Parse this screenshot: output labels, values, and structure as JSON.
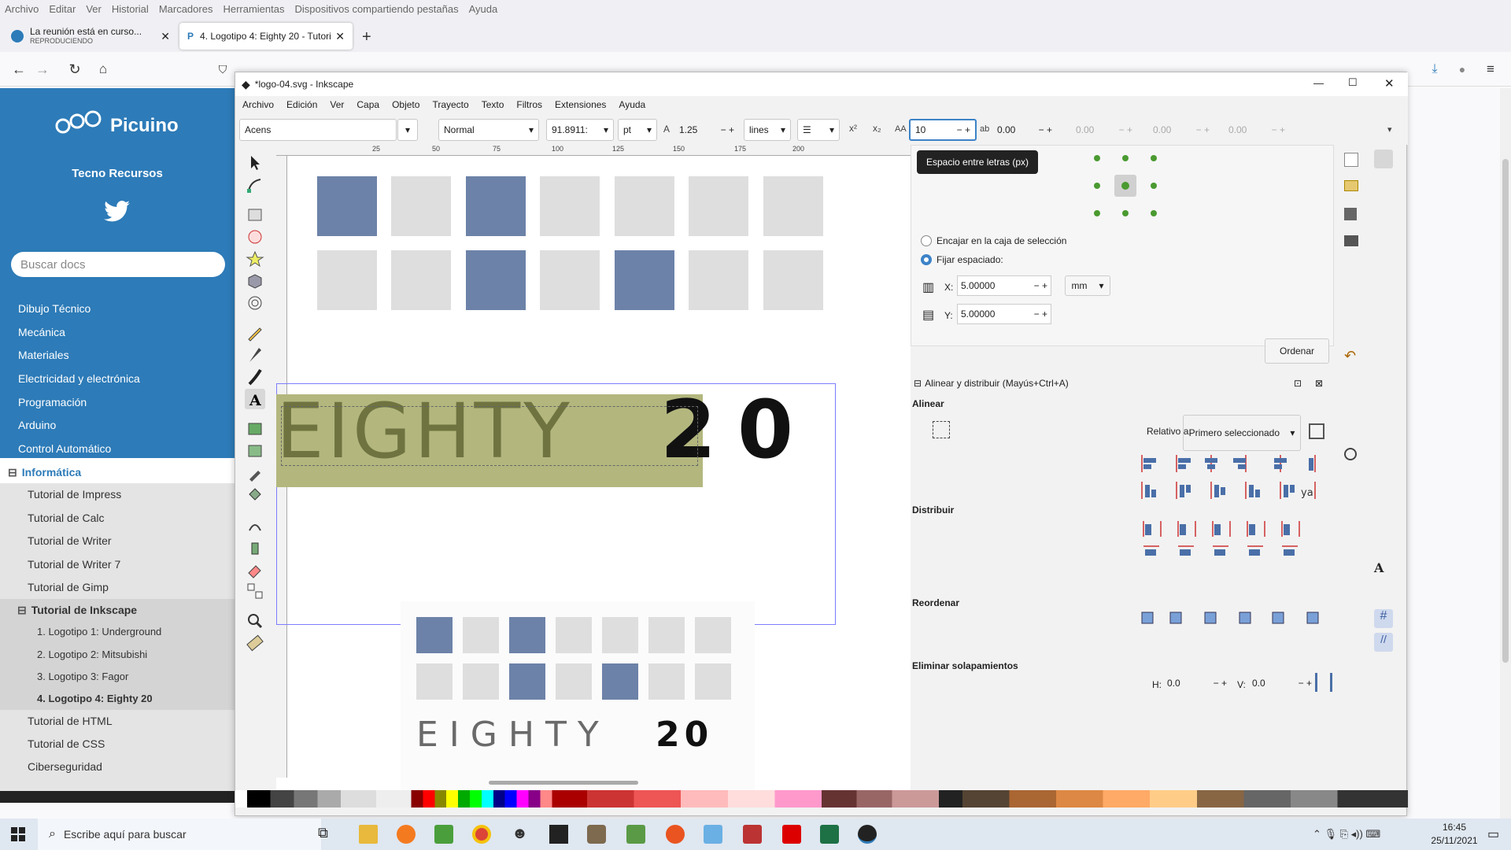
{
  "firefox": {
    "menu": [
      "Archivo",
      "Editar",
      "Ver",
      "Historial",
      "Marcadores",
      "Herramientas",
      "Dispositivos compartiendo pestañas",
      "Ayuda"
    ],
    "tab1": {
      "title": "La reunión está en curso...",
      "subtitle": "REPRODUCIENDO"
    },
    "tab2": {
      "title": "4. Logotipo 4: Eighty 20 - Tutori"
    }
  },
  "site": {
    "brand": "Picuino",
    "subtitle": "Tecno Recursos",
    "search_placeholder": "Buscar docs",
    "nav": [
      "Dibujo Técnico",
      "Mecánica",
      "Materiales",
      "Electricidad y electrónica",
      "Programación",
      "Arduino",
      "Control Automático"
    ],
    "section": "Informática",
    "items": [
      "Tutorial de Impress",
      "Tutorial de Calc",
      "Tutorial de Writer",
      "Tutorial de Writer 7",
      "Tutorial de Gimp"
    ],
    "current_section": "Tutorial de Inkscape",
    "subitems": [
      "1. Logotipo 1: Underground",
      "2. Logotipo 2: Mitsubishi",
      "3. Logotipo 3: Fagor",
      "4. Logotipo 4: Eighty 20"
    ],
    "after": [
      "Tutorial de HTML",
      "Tutorial de CSS",
      "Ciberseguridad"
    ]
  },
  "inkscape": {
    "title": "*logo-04.svg - Inkscape",
    "menu": [
      "Archivo",
      "Edición",
      "Ver",
      "Capa",
      "Objeto",
      "Trayecto",
      "Texto",
      "Filtros",
      "Extensiones",
      "Ayuda"
    ],
    "font_family": "Acens",
    "font_style": "Normal",
    "font_size": "91.8911:",
    "font_unit": "pt",
    "line_spacing": "1.25",
    "line_unit": "lines",
    "letter_spacing": "10",
    "word_spacing": "0.00",
    "kern_x": "0.00",
    "kern_y": "0.00",
    "rotation": "0.00",
    "tooltip": "Espacio entre letras (px)",
    "ruler": [
      "25",
      "50",
      "75",
      "100",
      "125",
      "150",
      "175",
      "200"
    ],
    "canvas_text_a": "EIGHTY",
    "canvas_text_b": "2",
    "canvas_text_c": "0",
    "ref_text_a": "EIGHTY",
    "ref_text_b": "20"
  },
  "arrange": {
    "fit_label": "Encajar en la caja de selección",
    "fix_label": "Fijar espaciado:",
    "x_label": "X:",
    "x_value": "5.00000",
    "y_label": "Y:",
    "y_value": "5.00000",
    "unit": "mm",
    "order_button": "Ordenar"
  },
  "align": {
    "header": "Alinear y distribuir (Mayús+Ctrl+A)",
    "align_label": "Alinear",
    "relative_label": "Relativo a:",
    "relative_value": "Primero seleccionado",
    "distribute_label": "Distribuir",
    "reorder_label": "Reordenar",
    "overlap_label": "Eliminar solapamientos",
    "h_label": "H:",
    "h_value": "0.0",
    "v_label": "V:",
    "v_value": "0.0"
  },
  "taskbar": {
    "search_placeholder": "Escribe aquí para buscar",
    "time": "16:45",
    "date": "25/11/2021"
  },
  "colors": {
    "accent": "#2d7bb8",
    "logo_blue": "#6c82a8",
    "logo_gray": "#dedede",
    "selection_fill": "#b3b77e"
  }
}
